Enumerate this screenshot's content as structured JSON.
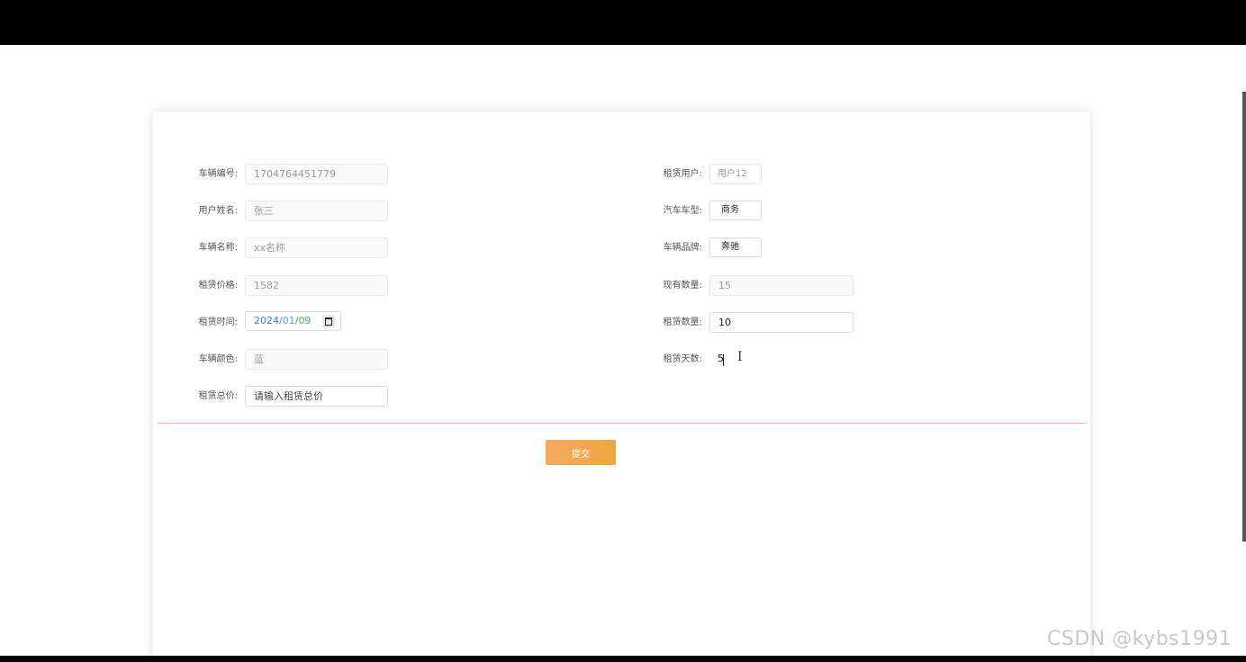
{
  "form": {
    "left": [
      {
        "label": "车辆编号:",
        "value": "1704764451779"
      },
      {
        "label": "用户姓名:",
        "value": "张三"
      },
      {
        "label": "车辆名称:",
        "value": "xx名称"
      },
      {
        "label": "租赁价格:",
        "value": "1582"
      },
      {
        "label": "租赁时间:",
        "date": {
          "year": "2024",
          "month": "01",
          "day": "09",
          "sep": "/"
        }
      },
      {
        "label": "车辆颜色:",
        "value": "蓝"
      },
      {
        "label": "租赁总价:",
        "placeholder": "请输入租赁总价"
      }
    ],
    "right": [
      {
        "label": "租赁用户:",
        "value": "用户12"
      },
      {
        "label": "汽车车型:",
        "value": "商务"
      },
      {
        "label": "车辆品牌:",
        "value": "奔驰"
      },
      {
        "label": "现有数量:",
        "value": "15"
      },
      {
        "label": "租赁数量:",
        "value": "10"
      },
      {
        "label": "租赁天数:",
        "value": "5"
      }
    ],
    "submit_label": "提交"
  },
  "watermark": "CSDN @kybs1991",
  "colors": {
    "accent": "#f0a63e",
    "divider": "#f0b896",
    "date_year": "#3a7fd5",
    "date_month": "#48b1c8",
    "date_day": "#4ab54a"
  }
}
